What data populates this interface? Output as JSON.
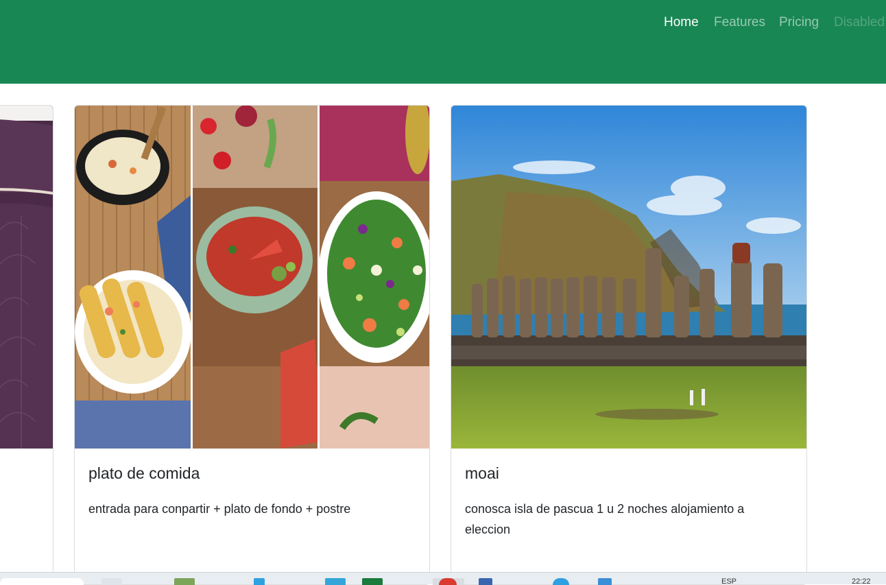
{
  "navbar": {
    "links": [
      {
        "label": "Home",
        "state": "active"
      },
      {
        "label": "Features",
        "state": "normal"
      },
      {
        "label": "Pricing",
        "state": "normal"
      },
      {
        "label": "Disabled",
        "state": "disabled"
      }
    ],
    "colors": {
      "background": "#198754"
    }
  },
  "cards": [
    {
      "title": "",
      "text": "",
      "image": "purple-quilt-photo"
    },
    {
      "title": "plato de comida",
      "text": "entrada para conpartir + plato de fondo + postre",
      "image": "food-collage-photo"
    },
    {
      "title": "moai",
      "text": "conosca isla de pascua 1 u 2 noches alojamiento a eleccion",
      "image": "easter-island-moai-photo"
    }
  ],
  "taskbar": {
    "tray_text": "ESP",
    "clock": "22:22"
  }
}
